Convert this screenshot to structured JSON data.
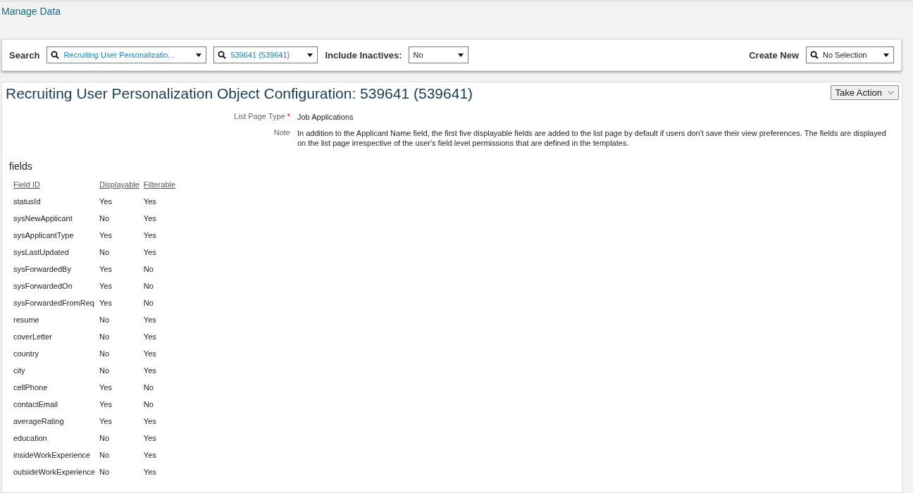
{
  "page_title": "Manage Data",
  "search_bar": {
    "search_label": "Search",
    "search_fields": [
      {
        "kind": "search",
        "value": "Recruiting User Personalizatio...",
        "linked": true
      },
      {
        "kind": "search",
        "value": "539641 (539641)",
        "linked": true
      }
    ],
    "inactives_label": "Include Inactives:",
    "inactives_field": {
      "value": "No",
      "linked": false
    },
    "create_label": "Create New",
    "create_field": {
      "kind": "search",
      "value": "No Selection",
      "linked": false
    }
  },
  "record": {
    "title": "Recruiting User Personalization Object Configuration: 539641 (539641)",
    "action_button": "Take Action",
    "properties": [
      {
        "label": "List Page Type",
        "required_mark": "*",
        "value": "Job Applications"
      },
      {
        "label": "Note",
        "value": "In addition to the Applicant Name field, the first five displayable fields are added to the list page by default if users don't save their view preferences. The fields are displayed on the list page irrespective of the user's field level permissions that are defined in the templates."
      }
    ],
    "section_title": "fields",
    "columns": [
      "Field ID",
      "Displayable",
      "Filterable"
    ],
    "rows": [
      [
        "statusId",
        "Yes",
        "Yes"
      ],
      [
        "sysNewApplicant",
        "No",
        "Yes"
      ],
      [
        "sysApplicantType",
        "Yes",
        "Yes"
      ],
      [
        "sysLastUpdated",
        "No",
        "Yes"
      ],
      [
        "sysForwardedBy",
        "Yes",
        "No"
      ],
      [
        "sysForwardedOn",
        "Yes",
        "No"
      ],
      [
        "sysForwardedFromReq",
        "Yes",
        "No"
      ],
      [
        "resume",
        "No",
        "Yes"
      ],
      [
        "coverLetter",
        "No",
        "Yes"
      ],
      [
        "country",
        "No",
        "Yes"
      ],
      [
        "city",
        "No",
        "Yes"
      ],
      [
        "cellPhone",
        "Yes",
        "No"
      ],
      [
        "contactEmail",
        "Yes",
        "No"
      ],
      [
        "averageRating",
        "Yes",
        "Yes"
      ],
      [
        "education",
        "No",
        "Yes"
      ],
      [
        "insideWorkExperience",
        "No",
        "Yes"
      ],
      [
        "outsideWorkExperience",
        "No",
        "Yes"
      ]
    ]
  }
}
